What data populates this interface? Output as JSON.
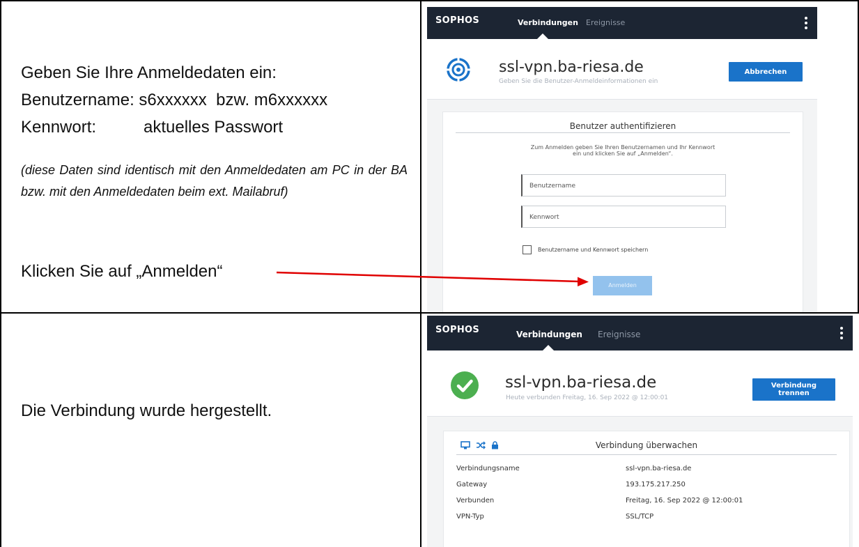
{
  "row1": {
    "line1": "Geben Sie Ihre Anmeldedaten ein:",
    "line2": "Benutzername: s6xxxxxx  bzw. m6xxxxxx",
    "line3_label": "Kennwort:",
    "line3_value": "aktuelles Passwort",
    "note": "(diese Daten sind identisch mit den Anmeldedaten am PC in der BA bzw. mit den Anmeldedaten beim ext. Mailabruf)",
    "instruction": "Klicken Sie auf „Anmelden“"
  },
  "row2": {
    "text": "Die Verbindung wurde hergestellt."
  },
  "window1": {
    "brand": "SOPHOS",
    "tabs": [
      "Verbindungen",
      "Ereignisse"
    ],
    "hostname": "ssl-vpn.ba-riesa.de",
    "subtitle": "Geben Sie die Benutzer-Anmeldeinformationen ein",
    "action_button": "Abbrechen",
    "card_title": "Benutzer authentifizieren",
    "card_text_1": "Zum Anmelden geben Sie Ihren Benutzernamen und Ihr Kennwort",
    "card_text_2": "ein und klicken Sie auf „Anmelden“.",
    "username_placeholder": "Benutzername",
    "password_placeholder": "Kennwort",
    "remember_label": "Benutzername und Kennwort speichern",
    "login_button": "Anmelden"
  },
  "window2": {
    "brand": "SOPHOS",
    "tabs": [
      "Verbindungen",
      "Ereignisse"
    ],
    "hostname": "ssl-vpn.ba-riesa.de",
    "subtitle": "Heute verbunden Freitag, 16. Sep 2022 @ 12:00:01",
    "action_button_line1": "Verbindung",
    "action_button_line2": "trennen",
    "card_title": "Verbindung überwachen",
    "details": [
      {
        "key": "Verbindungsname",
        "value": "ssl-vpn.ba-riesa.de"
      },
      {
        "key": "Gateway",
        "value": "193.175.217.250"
      },
      {
        "key": "Verbunden",
        "value": "Freitag, 16. Sep 2022 @ 12:00:01"
      },
      {
        "key": "VPN-Typ",
        "value": "SSL/TCP"
      }
    ]
  },
  "colors": {
    "navbar": "#1c2533",
    "button_blue": "#1a73c9",
    "disabled_blue": "#93c2ed",
    "success_green": "#4caf50",
    "arrow_red": "#e00000"
  }
}
